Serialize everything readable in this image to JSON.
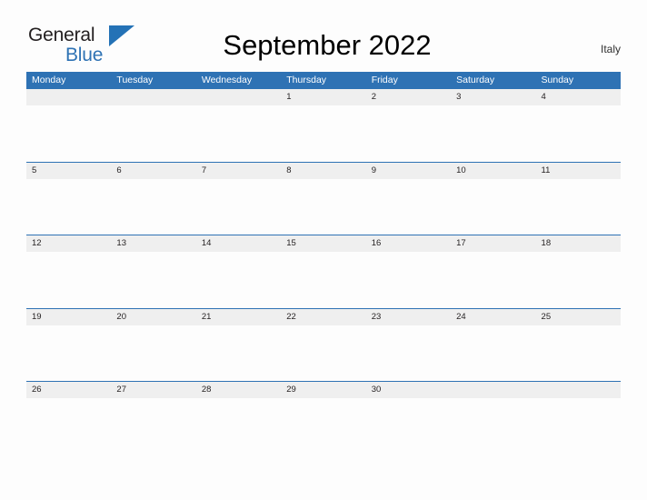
{
  "brand": {
    "name_part1": "General",
    "name_part2": "Blue",
    "triangle_icon": "brand-triangle-icon",
    "accent_color": "#2e72b4"
  },
  "header": {
    "title": "September 2022",
    "country": "Italy"
  },
  "calendar": {
    "month": "September",
    "year": "2022",
    "weekday_headers": [
      "Monday",
      "Tuesday",
      "Wednesday",
      "Thursday",
      "Friday",
      "Saturday",
      "Sunday"
    ],
    "weeks": [
      [
        "",
        "",
        "",
        "1",
        "2",
        "3",
        "4"
      ],
      [
        "5",
        "6",
        "7",
        "8",
        "9",
        "10",
        "11"
      ],
      [
        "12",
        "13",
        "14",
        "15",
        "16",
        "17",
        "18"
      ],
      [
        "19",
        "20",
        "21",
        "22",
        "23",
        "24",
        "25"
      ],
      [
        "26",
        "27",
        "28",
        "29",
        "30",
        "",
        ""
      ]
    ],
    "header_bg_color": "#2e72b4",
    "date_band_color": "#efefef",
    "row_divider_color": "#2e72b4"
  }
}
